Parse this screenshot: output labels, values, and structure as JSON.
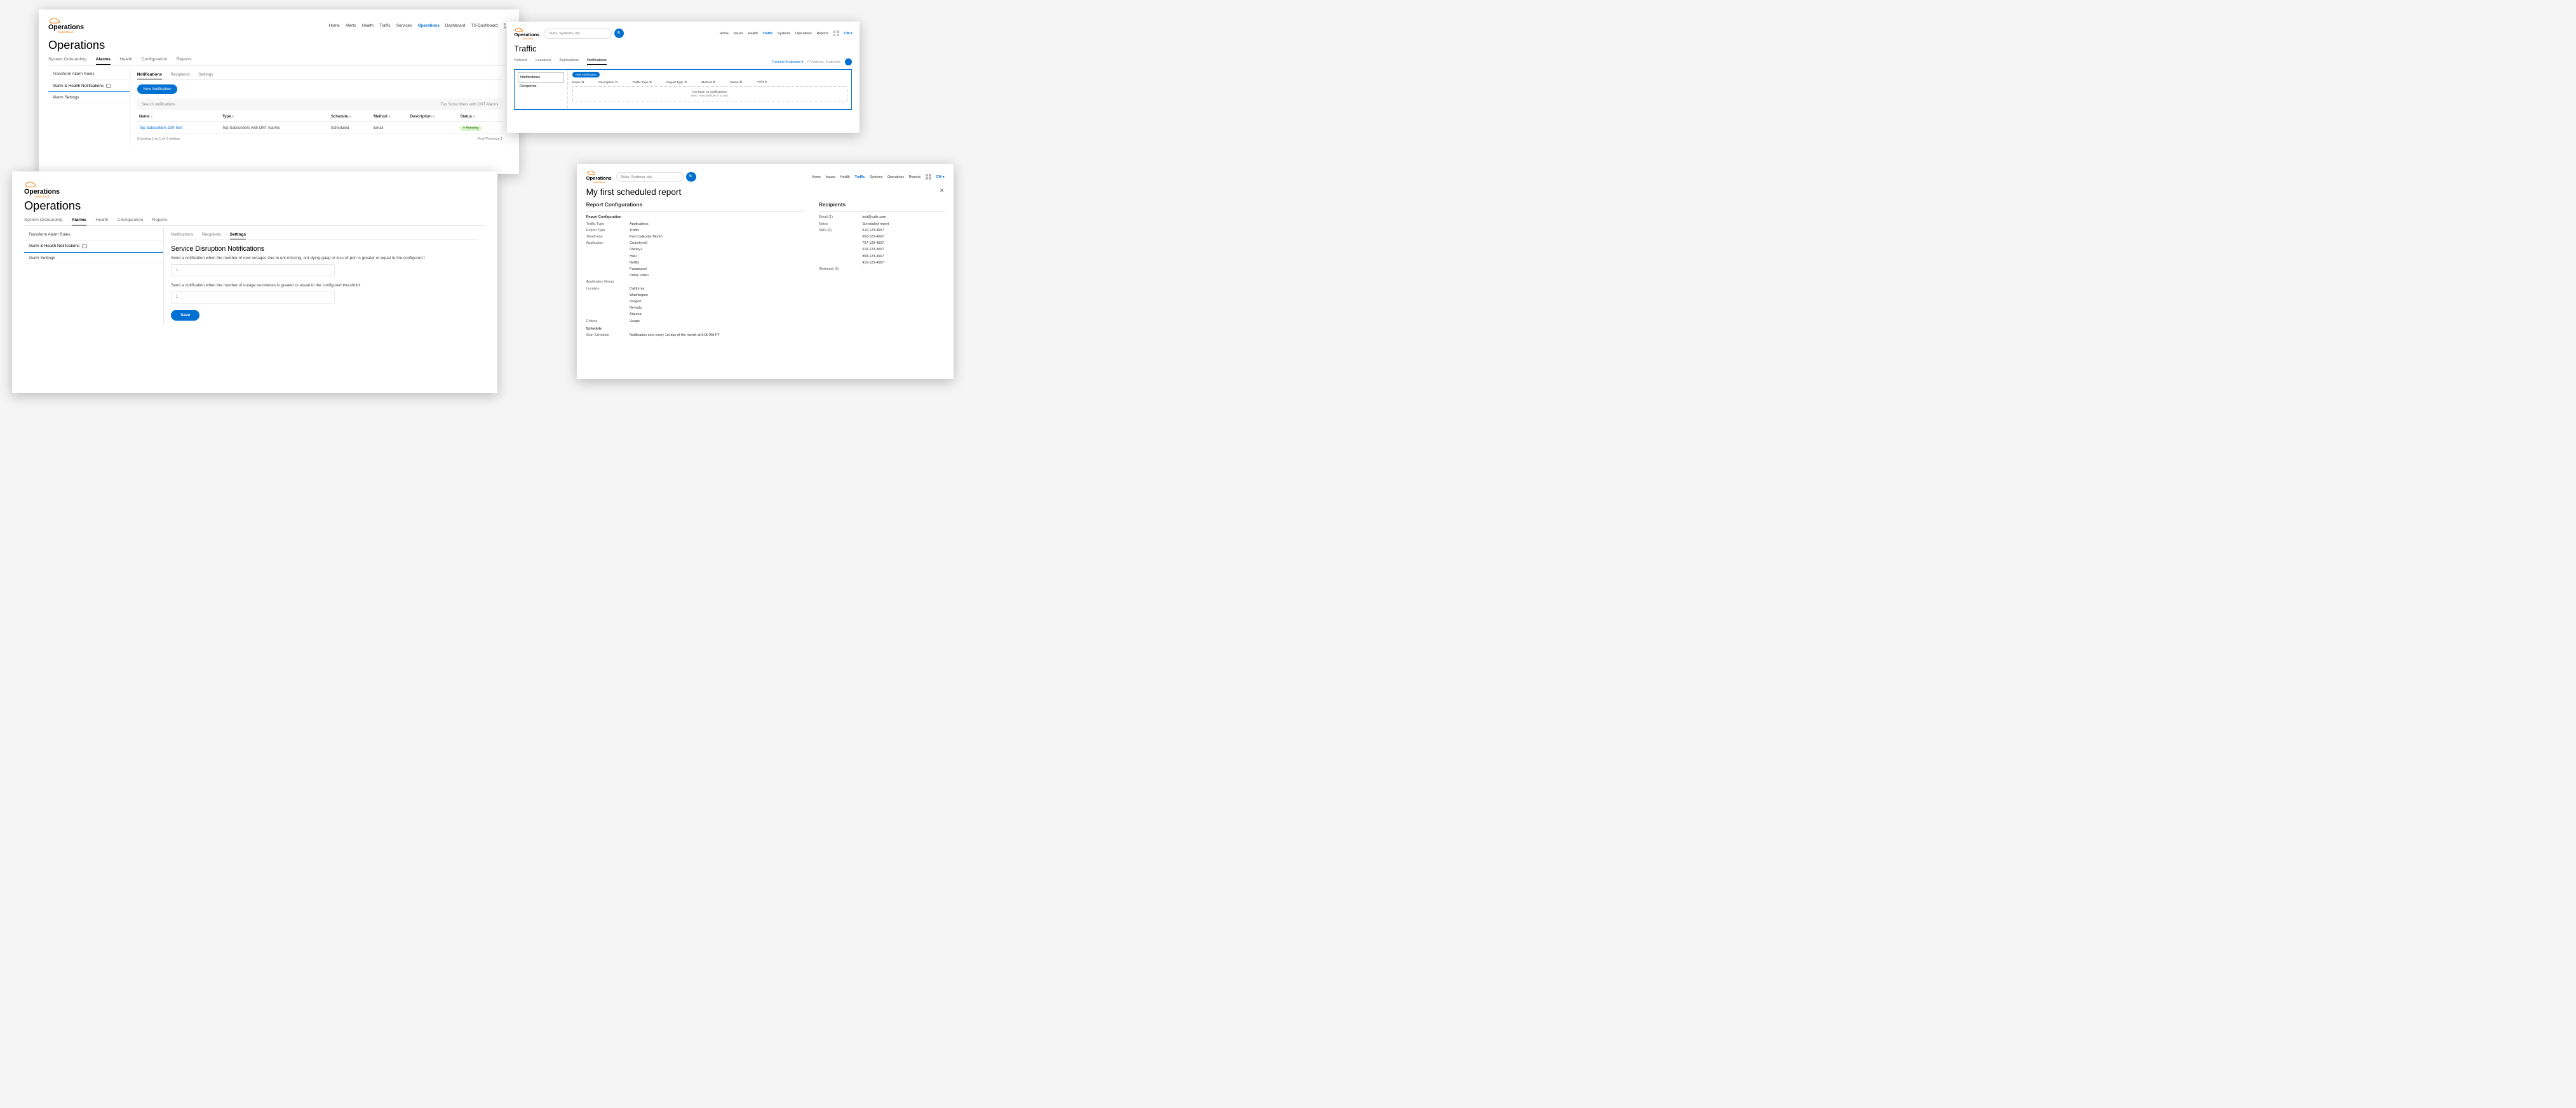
{
  "brand": "Operations",
  "brand_sub": "CalixCloud",
  "w1": {
    "nav": [
      "Home",
      "Alerts",
      "Health",
      "Traffic",
      "Services",
      "Operations",
      "Dashboard",
      "TS-Dashboard"
    ],
    "nav_active": "Operations",
    "title": "Operations",
    "tabs": [
      "System Onboarding",
      "Alarms",
      "Health",
      "Configuration",
      "Reports"
    ],
    "tab_sel": "Alarms",
    "side": [
      "Transform Alarm Rules",
      "Alarm & Health Notifications",
      "Alarm Settings"
    ],
    "side_sel": "Alarm & Health Notifications",
    "subtabs": [
      "Notifications",
      "Recipients",
      "Settings"
    ],
    "subtab_sel": "Notifications",
    "new_btn": "New Notification",
    "search_ph": "Search notifications",
    "search_right": "Top Subscribers with ONT Alarms",
    "cols": [
      "Name",
      "Type",
      "Schedule",
      "Method",
      "Description",
      "Status"
    ],
    "row": {
      "name": "Top Subscribers 100 Test",
      "type": "Top Subscribers with ONT Alarms",
      "schedule": "Scheduled",
      "method": "Email",
      "desc": "",
      "status": "Running"
    },
    "pager_left": "Showing 1 to 1 of 1 entries",
    "pager_right": "First    Previous   1"
  },
  "w2": {
    "title": "Operations",
    "tabs": [
      "System Onboarding",
      "Alarms",
      "Health",
      "Configuration",
      "Reports"
    ],
    "tab_sel": "Alarms",
    "side": [
      "Transform Alarm Rules",
      "Alarm & Health Notifications",
      "Alarm Settings"
    ],
    "side_sel": "Alarm & Health Notifications",
    "subtabs": [
      "Notifications",
      "Recipients",
      "Settings"
    ],
    "subtab_sel": "Settings",
    "section": "Service Disruption Notifications",
    "line1": "Send a notification when the number of new outages due to ont-missing, ont-dying-gasp or loss-of-pon is greater or equal to the configured t",
    "val1": "1",
    "line2": "Send a notification when the number of outage recoveries is greater or equal to the configured threshold:",
    "val2": "1",
    "save": "Save"
  },
  "w3": {
    "search_ph": "Subs, Systems, etc.",
    "nav": [
      "Home",
      "Issues",
      "Health",
      "Traffic",
      "Systems",
      "Operations",
      "Reports"
    ],
    "nav_active": "Traffic",
    "user": "CW",
    "title": "Traffic",
    "subnav": [
      "Network",
      "Locations",
      "Applications",
      "Notifications"
    ],
    "subnav_sel": "Notifications",
    "fav": "Favorite Endpoints",
    "ip_ph": "IP Address, Endpoints",
    "side": [
      "Notifications",
      "Recipients"
    ],
    "side_sel": "Notifications",
    "new_btn": "New Notification",
    "cols": [
      "Name",
      "Description",
      "Traffic Type",
      "Report Type",
      "Method",
      "Status",
      "Actions"
    ],
    "empty1": "You have no notifications.",
    "empty2": "Select \"New Notification\" to start."
  },
  "w4": {
    "search_ph": "Subs, Systems, etc.",
    "nav": [
      "Home",
      "Issues",
      "Health",
      "Traffic",
      "Systems",
      "Operations",
      "Reports"
    ],
    "nav_active": "Traffic",
    "user": "CW",
    "title": "My first scheduled report",
    "sec1": "Report Configurations",
    "sec2": "Recipients",
    "cfg_header": "Report Configuration",
    "cfg": [
      [
        "Traffic Type",
        "Applications"
      ],
      [
        "Report Type",
        "Traffic"
      ],
      [
        "Timeframe",
        "Past Calendar Month"
      ],
      [
        "Application",
        "Crunchyroll\nDisney+\nHulu\nNetflix\nParamount\nPrime Video"
      ],
      [
        "Application Group",
        ""
      ],
      [
        "Location",
        "California\nWashington\nOregon\nNevada\nArizona"
      ],
      [
        "Criteria",
        "Usage"
      ]
    ],
    "schedule_header": "Schedule",
    "schedule": [
      [
        "Start Schedule",
        "Notification sent every 1st day of the month at 9:00 AM PT"
      ]
    ],
    "recip": [
      [
        "Email (1)",
        "test@calix.com"
      ],
      [
        "Notes",
        "Scheduled report"
      ],
      [
        "SMS (6)",
        "510-123-4567\n650-123-4567\n707-123-4567\n619-123-4567\n858-123-4567\n415-123-4567"
      ],
      [
        "Webhook (0)",
        "-"
      ]
    ]
  }
}
